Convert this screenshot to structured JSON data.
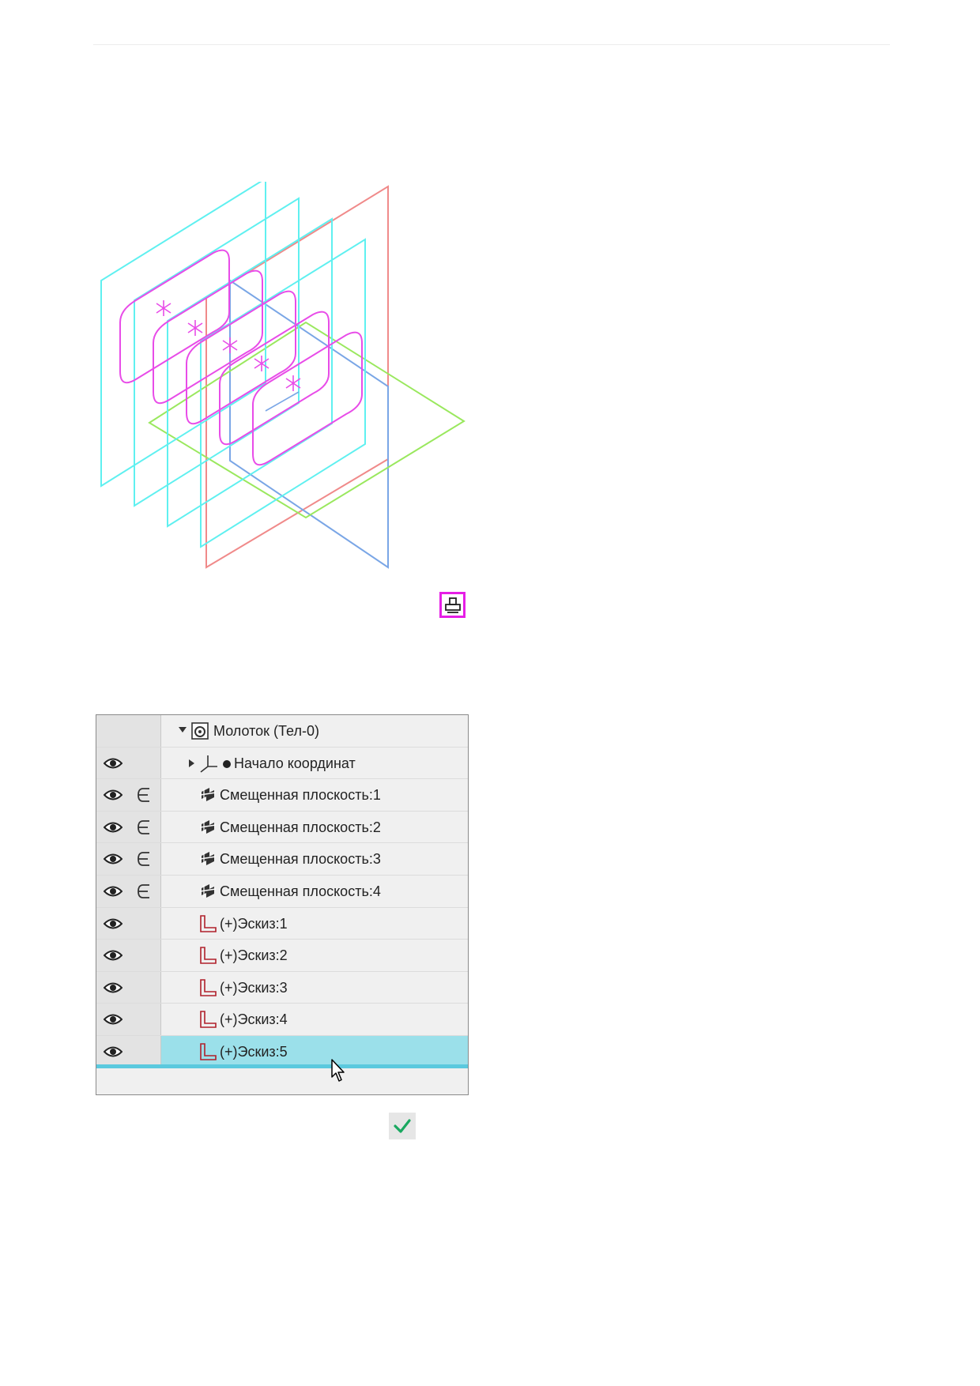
{
  "tree": {
    "root": {
      "label": "Молоток (Тел-0)",
      "expanded": true,
      "icon": "body-icon"
    },
    "items": [
      {
        "label": "Начало координат",
        "type": "origin",
        "visible": true,
        "member": false,
        "expander": "collapsed"
      },
      {
        "label": "Смещенная плоскость:1",
        "type": "plane",
        "visible": true,
        "member": true
      },
      {
        "label": "Смещенная плоскость:2",
        "type": "plane",
        "visible": true,
        "member": true
      },
      {
        "label": "Смещенная плоскость:3",
        "type": "plane",
        "visible": true,
        "member": true
      },
      {
        "label": "Смещенная плоскость:4",
        "type": "plane",
        "visible": true,
        "member": true
      },
      {
        "label": "(+)Эскиз:1",
        "type": "sketch",
        "visible": true,
        "member": false
      },
      {
        "label": "(+)Эскиз:2",
        "type": "sketch",
        "visible": true,
        "member": false
      },
      {
        "label": "(+)Эскиз:3",
        "type": "sketch",
        "visible": true,
        "member": false
      },
      {
        "label": "(+)Эскиз:4",
        "type": "sketch",
        "visible": true,
        "member": false
      },
      {
        "label": "(+)Эскиз:5",
        "type": "sketch",
        "visible": true,
        "member": false,
        "selected": true
      }
    ]
  },
  "colors": {
    "offset_planes": "#5ff0f0",
    "sketches": "#e84ce8",
    "plane_xy": "#f08a8a",
    "plane_zy": "#7aa6e6",
    "plane_zx": "#9ae85e",
    "selection": "#9be0ea",
    "highlight_border": "#e61ee6",
    "ok_check": "#1aa860"
  },
  "buttons": {
    "highlighted_tool": "print-preview-icon",
    "confirm": "checkmark-icon"
  }
}
